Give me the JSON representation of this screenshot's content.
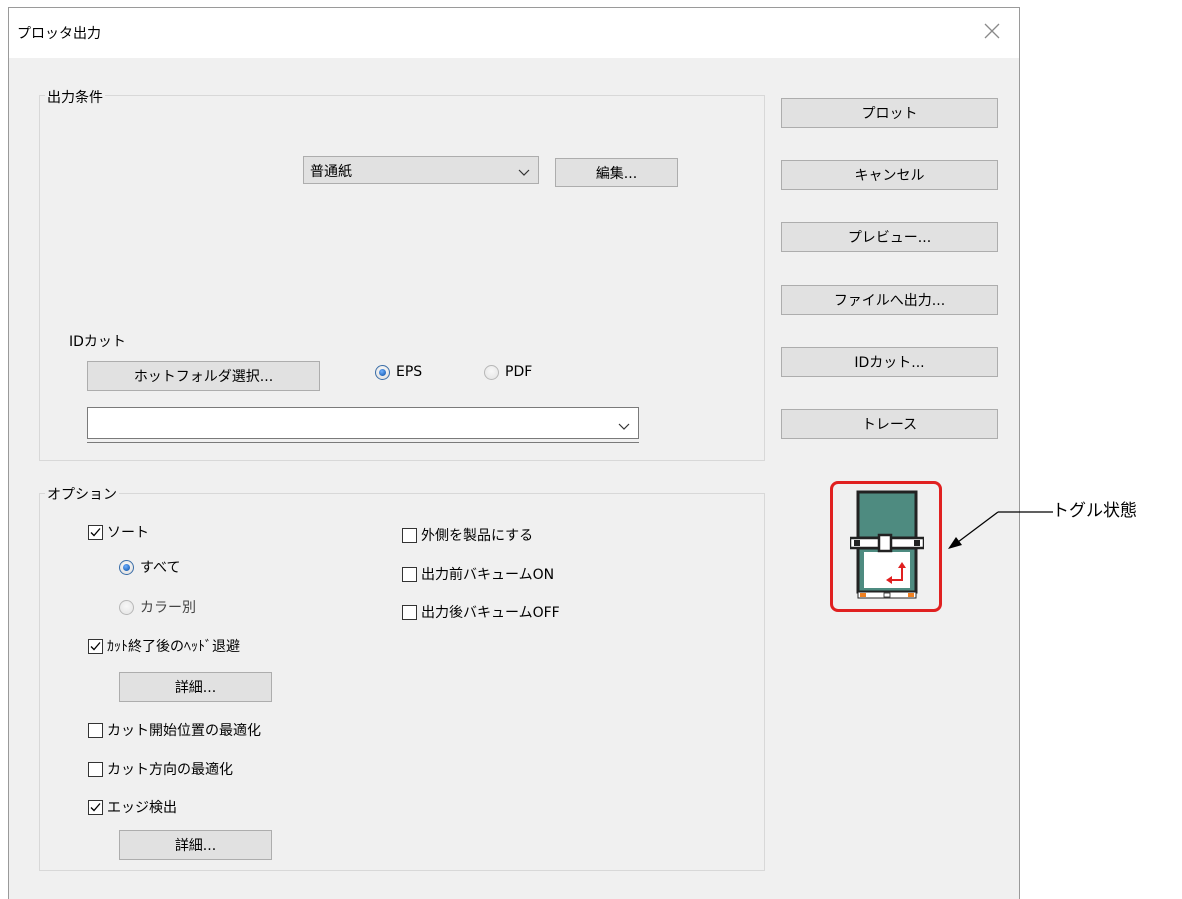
{
  "window": {
    "title": "プロッタ出力"
  },
  "output_conditions": {
    "group_label": "出力条件",
    "paper_select_value": "普通紙",
    "edit_button_label": "編集..."
  },
  "id_cut": {
    "label": "IDカット",
    "hot_folder_button_label": "ホットフォルダ選択...",
    "format_options": [
      {
        "label": "EPS",
        "selected": true
      },
      {
        "label": "PDF",
        "selected": false
      }
    ],
    "path_value": ""
  },
  "options": {
    "group_label": "オプション",
    "sort": {
      "label": "ソート",
      "checked": true
    },
    "sort_mode": [
      {
        "label": "すべて",
        "selected": true
      },
      {
        "label": "カラー別",
        "selected": false
      }
    ],
    "head_retract": {
      "label": "ｶｯﾄ終了後のﾍｯﾄﾞ退避",
      "checked": true
    },
    "head_retract_detail_label": "詳細...",
    "cut_start_optimize": {
      "label": "カット開始位置の最適化",
      "checked": false
    },
    "cut_direction_optimize": {
      "label": "カット方向の最適化",
      "checked": false
    },
    "edge_detect": {
      "label": "エッジ検出",
      "checked": true
    },
    "edge_detect_detail_label": "詳細...",
    "outside_as_product": {
      "label": "外側を製品にする",
      "checked": false
    },
    "vacuum_on_before": {
      "label": "出力前バキュームON",
      "checked": false
    },
    "vacuum_off_after": {
      "label": "出力後バキュームOFF",
      "checked": false
    }
  },
  "actions": {
    "plot": "プロット",
    "cancel": "キャンセル",
    "preview": "プレビュー...",
    "output_to_file": "ファイルへ出力...",
    "id_cut": "IDカット...",
    "trace": "トレース"
  },
  "annotation": {
    "callout_text": "トグル状態",
    "frame_color": "#e02020"
  },
  "colors": {
    "dialog_bg": "#f0f0f0",
    "button_bg": "#e1e1e1",
    "plotter_body": "#4e8b80"
  }
}
